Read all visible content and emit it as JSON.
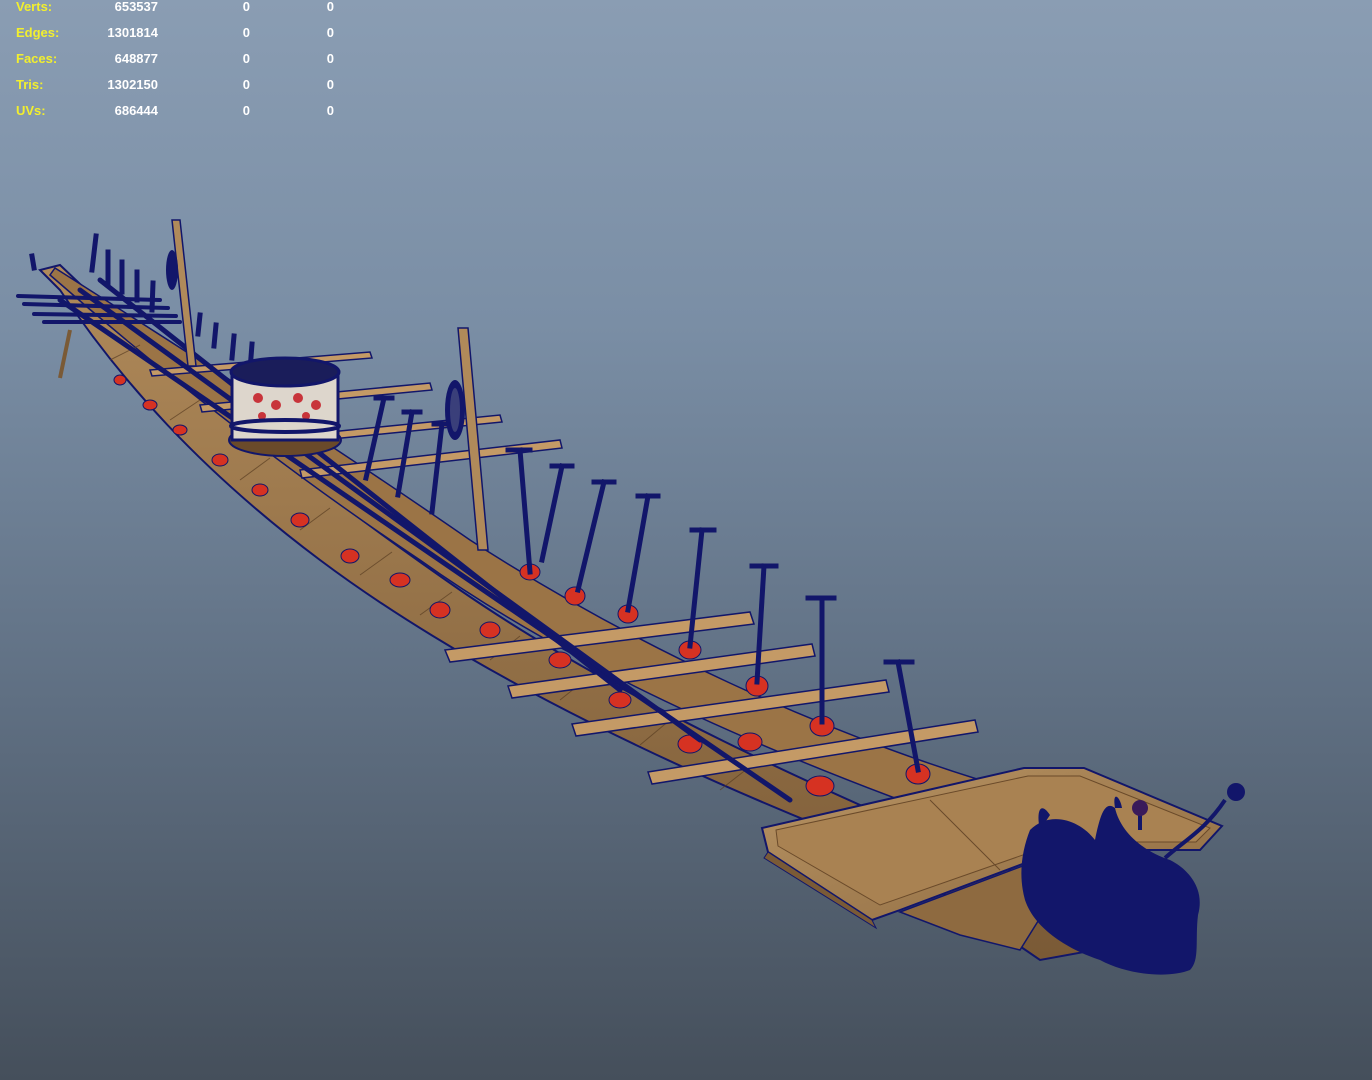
{
  "viewport": {
    "background_top": "#8a9db3",
    "background_bottom": "#454f5b",
    "wireframe_color": "#12166a",
    "wood_color": "#a07848",
    "paddle_color": "#d63222"
  },
  "hud": {
    "label_color": "#f2ef2e",
    "value_color": "#ffffff",
    "rows": [
      {
        "label": "Verts:",
        "total": "653537",
        "selected": "0",
        "component": "0"
      },
      {
        "label": "Edges:",
        "total": "1301814",
        "selected": "0",
        "component": "0"
      },
      {
        "label": "Faces:",
        "total": "648877",
        "selected": "0",
        "component": "0"
      },
      {
        "label": "Tris:",
        "total": "1302150",
        "selected": "0",
        "component": "0"
      },
      {
        "label": "UVs:",
        "total": "686444",
        "selected": "0",
        "component": "0"
      }
    ]
  },
  "model": {
    "name_icon": "dragon-boat-model",
    "parts": [
      "hull",
      "deck-platform",
      "dragon-head",
      "drum",
      "masts",
      "paddles",
      "benches"
    ]
  }
}
